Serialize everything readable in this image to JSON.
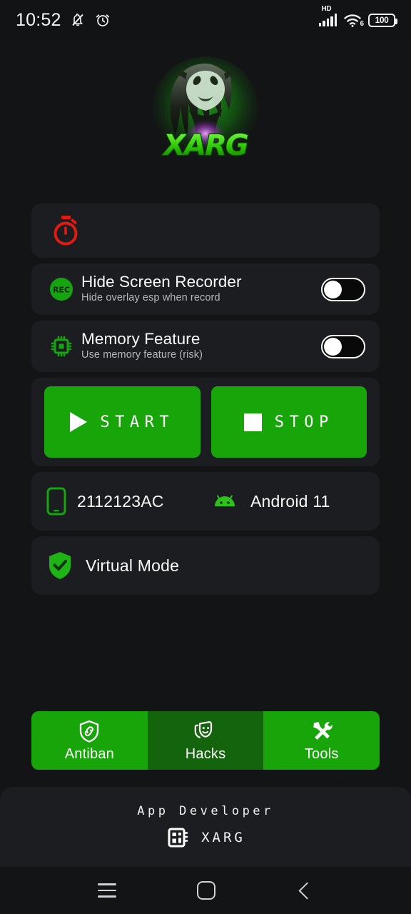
{
  "statusbar": {
    "time": "10:52",
    "icons": [
      "bell-mute-icon",
      "alarm-clock-icon"
    ],
    "network_label": "HD",
    "wifi_gen": "6",
    "battery_level": "100"
  },
  "app": {
    "logo_name": "xarg-logo",
    "logo_text": "XARG"
  },
  "timer_card": {
    "icon": "stopwatch-icon",
    "label": ""
  },
  "settings": [
    {
      "icon": "rec-icon",
      "icon_text": "REC",
      "title": "Hide Screen Recorder",
      "subtitle": "Hide overlay esp when record",
      "toggle_state": "off"
    },
    {
      "icon": "cpu-chip-icon",
      "title": "Memory Feature",
      "subtitle": "Use memory feature (risk)",
      "toggle_state": "off"
    }
  ],
  "actions": {
    "start_label": "START",
    "start_icon": "play-icon",
    "stop_label": "STOP",
    "stop_icon": "stop-square-icon"
  },
  "device": {
    "phone_icon": "smartphone-icon",
    "model": "2112123AC",
    "os_icon": "android-icon",
    "os_version": "Android 11"
  },
  "virtual_mode": {
    "icon": "shield-check-icon",
    "label": "Virtual Mode"
  },
  "tabs": [
    {
      "label": "Antiban",
      "icon": "shield-link-icon",
      "active": true
    },
    {
      "label": "Hacks",
      "icon": "theater-masks-icon",
      "active": false
    },
    {
      "label": "Tools",
      "icon": "wrench-screwdriver-icon",
      "active": true
    }
  ],
  "footer": {
    "title": "App Developer",
    "icon": "chip-card-icon",
    "name": "XARG"
  },
  "navbar": {
    "recents_icon": "menu-icon",
    "home_icon": "home-square-icon",
    "back_icon": "back-chevron-icon"
  },
  "colors": {
    "accent_green": "#17a50a",
    "dim_green": "#14630d",
    "card_bg": "#1c1d20",
    "page_bg": "#131416",
    "timer_red": "#e01b12"
  }
}
